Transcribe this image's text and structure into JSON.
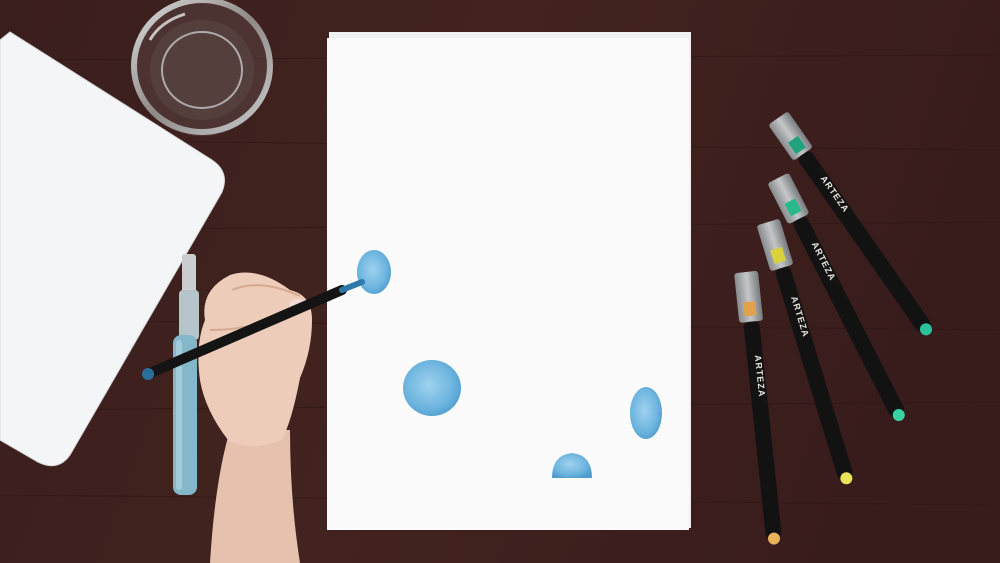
{
  "scene": {
    "description_type": "photo",
    "colors": {
      "table": "#3b1f1e",
      "table_grain": "#2a1514",
      "paper": "#fbfbfb",
      "paint": "#6fb6df",
      "marker_body": "#121212",
      "marker_cap": "#b9c0c3",
      "waterbrush": "#7fb3c6"
    }
  },
  "markers": [
    {
      "brand": "ARTEZA",
      "tip_color": "#2cc39a"
    },
    {
      "brand": "ARTEZA",
      "tip_color": "#38d3a0"
    },
    {
      "brand": "ARTEZA",
      "tip_color": "#e8e35a"
    },
    {
      "brand": "ARTEZA",
      "tip_color": "#e9b15c"
    }
  ]
}
